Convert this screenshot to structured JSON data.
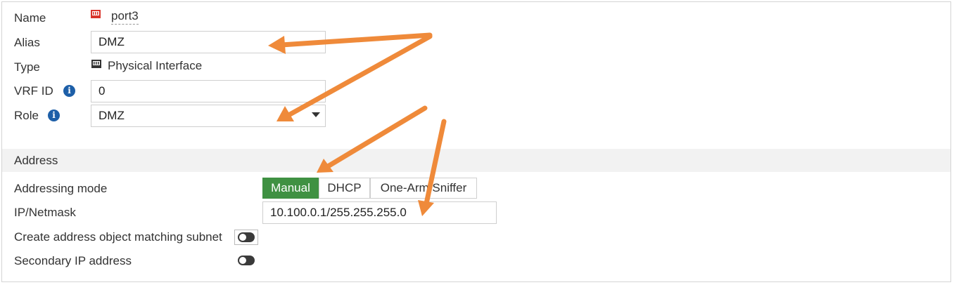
{
  "form": {
    "name_label": "Name",
    "name_value": "port3",
    "alias_label": "Alias",
    "alias_value": "DMZ",
    "type_label": "Type",
    "type_value": "Physical Interface",
    "vrf_label": "VRF ID",
    "vrf_value": "0",
    "role_label": "Role",
    "role_value": "DMZ"
  },
  "address": {
    "section_title": "Address",
    "mode_label": "Addressing mode",
    "modes": [
      "Manual",
      "DHCP",
      "One-Arm Sniffer"
    ],
    "active_mode": "Manual",
    "ip_label": "IP/Netmask",
    "ip_value": "10.100.0.1/255.255.255.0",
    "create_obj_label": "Create address object matching subnet",
    "create_obj_enabled": false,
    "secondary_label": "Secondary IP address",
    "secondary_enabled": false
  },
  "colors": {
    "accent_green": "#3f9142",
    "info_blue": "#1d5fa8",
    "port_red": "#d9342b",
    "annotation_arrow": "#ef8a3a"
  },
  "icons": {
    "port": "network-port-icon",
    "physical": "physical-interface-icon",
    "info": "info-icon",
    "dropdown": "chevron-down-icon"
  }
}
